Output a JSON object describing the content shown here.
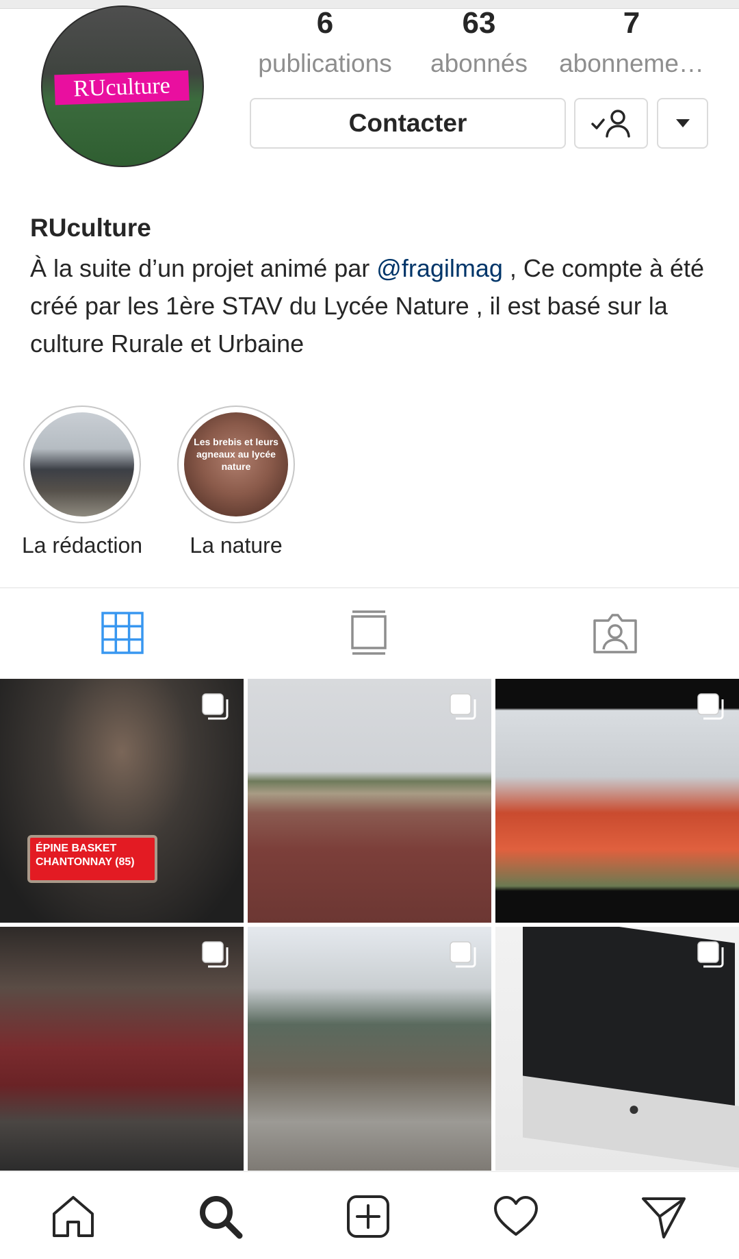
{
  "profile": {
    "avatar_text": "RUculture",
    "username": "RUculture",
    "stats": [
      {
        "value": "6",
        "label": "publications"
      },
      {
        "value": "63",
        "label": "abonnés"
      },
      {
        "value": "7",
        "label": "abonneme…"
      }
    ],
    "contact_button": "Contacter",
    "bio_prefix": "À la suite d’un projet animé par ",
    "bio_mention": "@fragilmag",
    "bio_suffix": " , Ce compte à été créé par les 1ère STAV du Lycée Nature , il est basé sur la culture Rurale et Urbaine"
  },
  "highlights": [
    {
      "label": "La rédaction"
    },
    {
      "label": "La nature",
      "overlay_text": "Les brebis et leurs agneaux au lycée nature"
    }
  ],
  "tabs": [
    {
      "icon": "grid-icon",
      "active": true
    },
    {
      "icon": "feed-icon",
      "active": false
    },
    {
      "icon": "tagged-icon",
      "active": false
    }
  ],
  "posts": [
    {
      "id": "post-1",
      "badge_text": "ÉPINE BASKET CHANTONNAY (85)",
      "multi": true
    },
    {
      "id": "post-2",
      "multi": true
    },
    {
      "id": "post-3",
      "multi": true
    },
    {
      "id": "post-4",
      "multi": true
    },
    {
      "id": "post-5",
      "multi": true
    },
    {
      "id": "post-6",
      "multi": true
    }
  ],
  "bottom_nav": [
    "home-icon",
    "search-icon",
    "new-post-icon",
    "activity-icon",
    "direct-icon"
  ],
  "colors": {
    "accent": "#3897f0",
    "mention": "#003569",
    "text": "#262626",
    "muted": "#8e8e8e"
  }
}
